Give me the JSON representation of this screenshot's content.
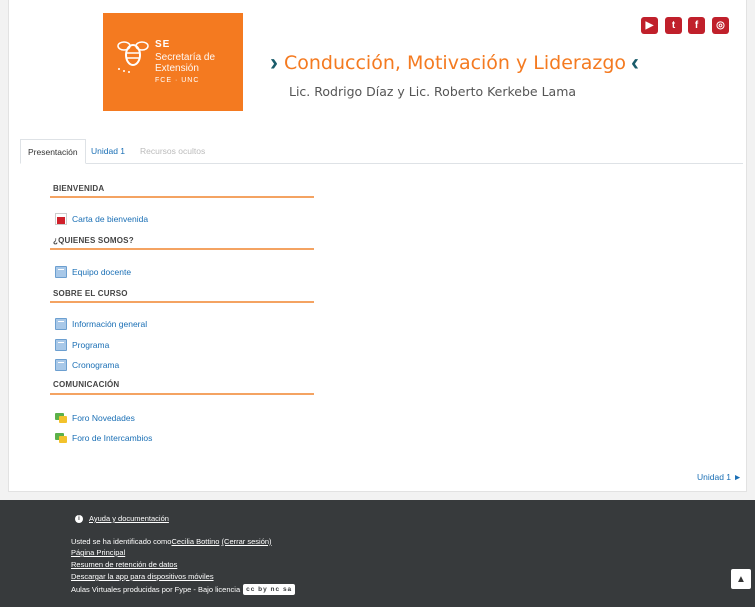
{
  "logo": {
    "acronym": "SE",
    "line1": "Secretaría de",
    "line2": "Extensión",
    "sub": "FCE · UNC"
  },
  "header": {
    "title": "Conducción, Motivación y Liderazgo",
    "subtitle": "Lic. Rodrigo Díaz y Lic. Roberto Kerkebe Lama",
    "chevron_left": "›",
    "chevron_right": "‹"
  },
  "social": [
    {
      "name": "youtube-icon",
      "glyph": "▶"
    },
    {
      "name": "twitter-icon",
      "glyph": "t"
    },
    {
      "name": "facebook-icon",
      "glyph": "f"
    },
    {
      "name": "instagram-icon",
      "glyph": "◎"
    }
  ],
  "tabs": [
    "Presentación",
    "Unidad 1",
    "Recursos ocultos"
  ],
  "sections": [
    {
      "title": "BIENVENIDA",
      "activities": [
        {
          "label": "Carta de bienvenida",
          "icon": "pdf-icon"
        }
      ]
    },
    {
      "title": "¿QUIENES SOMOS?",
      "activities": [
        {
          "label": "Equipo docente",
          "icon": "page-icon"
        }
      ]
    },
    {
      "title": "SOBRE EL CURSO",
      "activities": [
        {
          "label": "Información general",
          "icon": "page-icon"
        },
        {
          "label": "Programa",
          "icon": "page-icon"
        },
        {
          "label": "Cronograma",
          "icon": "page-icon"
        }
      ]
    },
    {
      "title": "COMUNICACIÓN",
      "activities": [
        {
          "label": "Foro Novedades",
          "icon": "forum-icon"
        },
        {
          "label": "Foro de Intercambios",
          "icon": "forum-icon"
        }
      ]
    }
  ],
  "next_section": "Unidad 1 ►",
  "footer": {
    "help": "Ayuda y documentación",
    "logged_prefix": "Usted se ha identificado como ",
    "user": "Cecilia Bottino",
    "logout": "(Cerrar sesión)",
    "home": "Página Principal",
    "retention": "Resumen de retención de datos",
    "app": "Descargar la app para dispositivos móviles",
    "credits": "Aulas Virtuales producidas por Fype - Bajo licencia",
    "license_badge": "cc by nc sa"
  },
  "back_to_top": "▲",
  "colors": {
    "brand_orange": "#f47a20",
    "footer_bg": "#373a3c",
    "link": "#1a6fb5",
    "social_red": "#c0202b"
  }
}
